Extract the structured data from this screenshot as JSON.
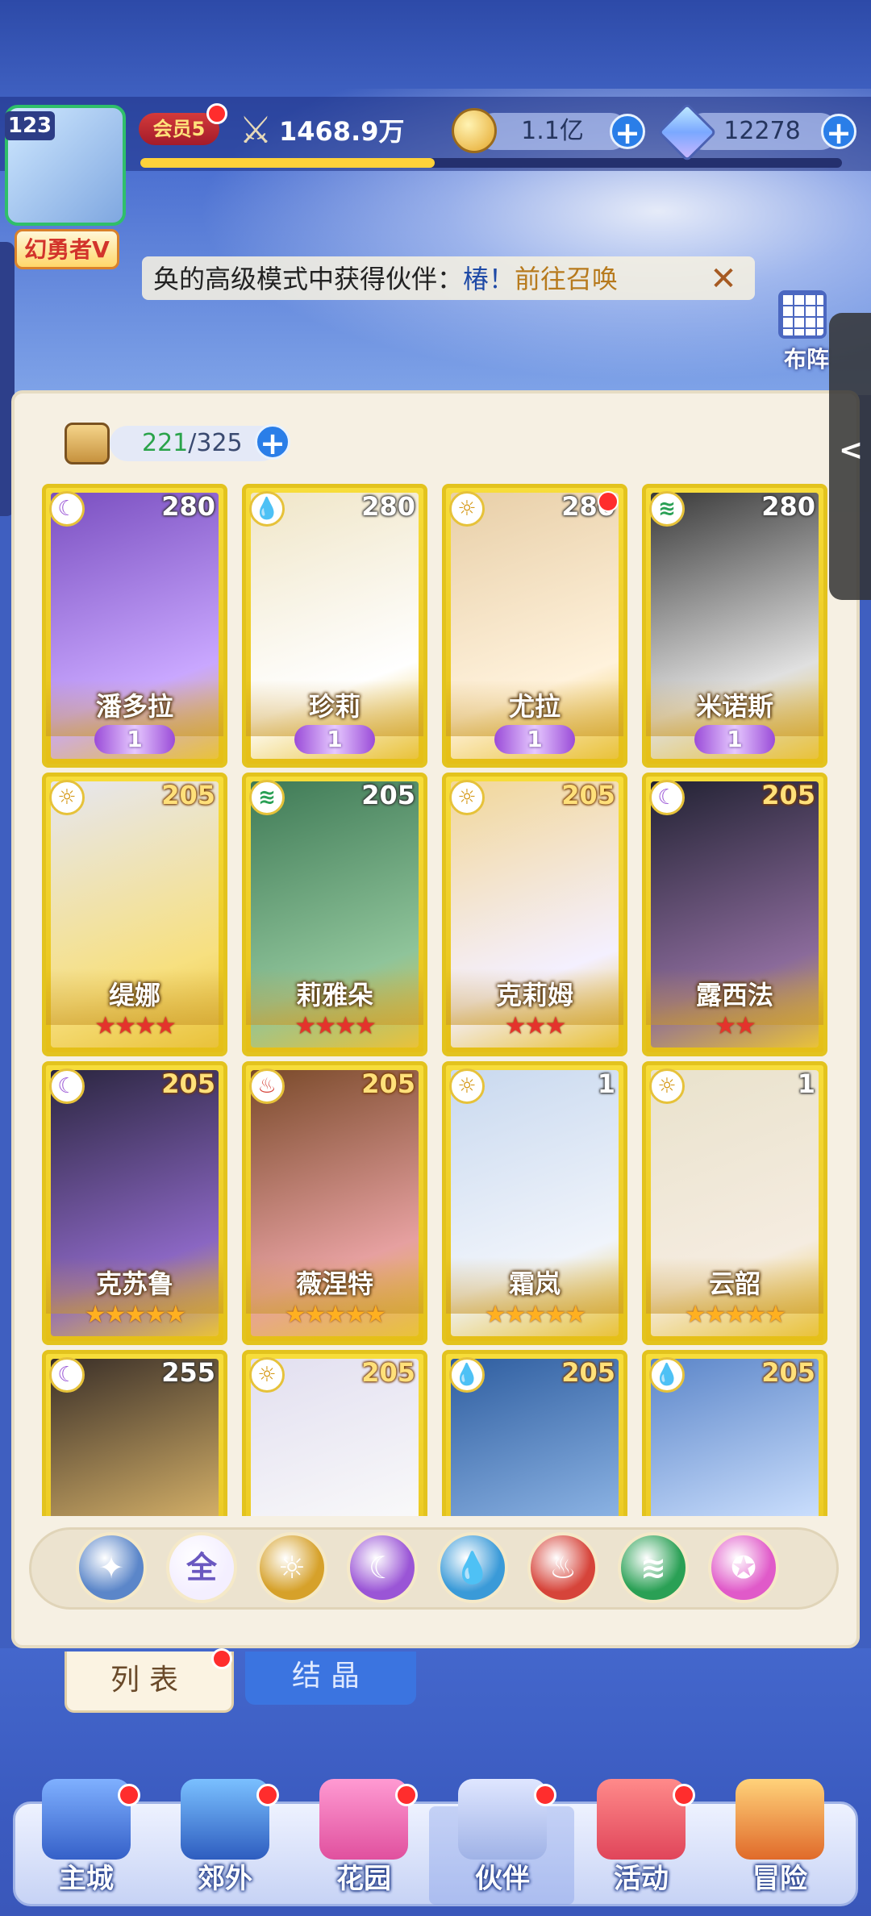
{
  "header": {
    "player_level": "123",
    "player_title": "幻勇者V",
    "vip_label": "会员5",
    "power": "1468.9万",
    "exp_progress": 0.42,
    "gold": "1.1亿",
    "diamonds": "12278"
  },
  "notice": {
    "text_prefix": "奂的高级模式中获得伙伴：",
    "partner": "椿！",
    "link": "前往召唤",
    "close": "✕"
  },
  "formation_label": "布阵",
  "side_tab_icon": "<",
  "bag": {
    "current": "221",
    "sep": "/",
    "max": "325"
  },
  "cards": [
    {
      "name": "潘多拉",
      "level": "280",
      "element": "moon",
      "elem_glyph": "☾",
      "elem_color": "#9a55d6",
      "stars": 0,
      "awaken": "1",
      "red_dot": false,
      "portrait": [
        "#7a4fc0",
        "#c9a7ff"
      ],
      "gold_level": false
    },
    {
      "name": "珍莉",
      "level": "280",
      "element": "water",
      "elem_glyph": "💧",
      "elem_color": "#3a9ad8",
      "stars": 0,
      "awaken": "1",
      "red_dot": false,
      "portrait": [
        "#f0e6c8",
        "#ffffff"
      ],
      "gold_level": false
    },
    {
      "name": "尤拉",
      "level": "280",
      "element": "light",
      "elem_glyph": "☼",
      "elem_color": "#d59a1a",
      "stars": 0,
      "awaken": "1",
      "red_dot": true,
      "portrait": [
        "#e8cfa8",
        "#fff2dc"
      ],
      "gold_level": false
    },
    {
      "name": "米诺斯",
      "level": "280",
      "element": "wind",
      "elem_glyph": "≋",
      "elem_color": "#2aa055",
      "stars": 0,
      "awaken": "1",
      "red_dot": false,
      "portrait": [
        "#3a3a3a",
        "#e0e0e0"
      ],
      "gold_level": false
    },
    {
      "name": "缇娜",
      "level": "205",
      "element": "light",
      "elem_glyph": "☼",
      "elem_color": "#d59a1a",
      "stars": 4,
      "star_color": "red",
      "red_dot": false,
      "portrait": [
        "#e6e6ef",
        "#f7e080"
      ],
      "gold_level": true
    },
    {
      "name": "莉雅朵",
      "level": "205",
      "element": "wind",
      "elem_glyph": "≋",
      "elem_color": "#2aa055",
      "stars": 4,
      "star_color": "red",
      "red_dot": false,
      "portrait": [
        "#3f7a56",
        "#8fc49a"
      ],
      "gold_level": false
    },
    {
      "name": "克莉姆",
      "level": "205",
      "element": "light",
      "elem_glyph": "☼",
      "elem_color": "#d59a1a",
      "stars": 3,
      "star_color": "red",
      "red_dot": false,
      "portrait": [
        "#f2d79a",
        "#f4f0ff"
      ],
      "gold_level": true
    },
    {
      "name": "露西法",
      "level": "205",
      "element": "moon",
      "elem_glyph": "☾",
      "elem_color": "#9a55d6",
      "stars": 2,
      "star_color": "red",
      "red_dot": false,
      "portrait": [
        "#222233",
        "#8a6a9a"
      ],
      "gold_level": true
    },
    {
      "name": "克苏鲁",
      "level": "205",
      "element": "moon",
      "elem_glyph": "☾",
      "elem_color": "#9a55d6",
      "stars": 5,
      "star_color": "gold",
      "red_dot": false,
      "portrait": [
        "#2b2640",
        "#8a66c2"
      ],
      "gold_level": true
    },
    {
      "name": "薇涅特",
      "level": "205",
      "element": "fire",
      "elem_glyph": "♨",
      "elem_color": "#d6443a",
      "stars": 5,
      "star_color": "gold",
      "red_dot": false,
      "portrait": [
        "#7a4a2a",
        "#e6a0a0"
      ],
      "gold_level": true
    },
    {
      "name": "霜岚",
      "level": "1",
      "element": "light",
      "elem_glyph": "☼",
      "elem_color": "#d59a1a",
      "stars": 5,
      "star_color": "gold",
      "red_dot": false,
      "portrait": [
        "#c9d9ef",
        "#f0f4fb"
      ],
      "gold_level": false
    },
    {
      "name": "云韶",
      "level": "1",
      "element": "light",
      "elem_glyph": "☼",
      "elem_color": "#d59a1a",
      "stars": 5,
      "star_color": "gold",
      "red_dot": false,
      "portrait": [
        "#e9e2cc",
        "#f5ece0"
      ],
      "gold_level": false
    },
    {
      "name": "",
      "level": "255",
      "element": "moon",
      "elem_glyph": "☾",
      "elem_color": "#9a55d6",
      "stars": 0,
      "red_dot": false,
      "portrait": [
        "#3a2f28",
        "#d9b46a"
      ],
      "gold_level": false
    },
    {
      "name": "",
      "level": "205",
      "element": "light",
      "elem_glyph": "☼",
      "elem_color": "#d59a1a",
      "stars": 0,
      "red_dot": false,
      "portrait": [
        "#e2dff0",
        "#fafafa"
      ],
      "gold_level": true
    },
    {
      "name": "",
      "level": "205",
      "element": "water",
      "elem_glyph": "💧",
      "elem_color": "#3a9ad8",
      "stars": 0,
      "red_dot": false,
      "portrait": [
        "#2f5ea0",
        "#8fb6e6"
      ],
      "gold_level": true
    },
    {
      "name": "",
      "level": "205",
      "element": "water",
      "elem_glyph": "💧",
      "elem_color": "#3a9ad8",
      "stars": 0,
      "red_dot": false,
      "portrait": [
        "#5c86c9",
        "#cfe2ff"
      ],
      "gold_level": true
    }
  ],
  "filters": [
    {
      "id": "special",
      "glyph": "✦",
      "color": "#5b86c9"
    },
    {
      "id": "all",
      "glyph": "全",
      "color": "#f4efff",
      "text_color": "#6a58c0"
    },
    {
      "id": "light",
      "glyph": "☼",
      "color": "#d6a12a"
    },
    {
      "id": "moon",
      "glyph": "☾",
      "color": "#9a55d6"
    },
    {
      "id": "water",
      "glyph": "💧",
      "color": "#3a9ad8"
    },
    {
      "id": "fire",
      "glyph": "♨",
      "color": "#d6443a"
    },
    {
      "id": "wind",
      "glyph": "≋",
      "color": "#2aa055"
    },
    {
      "id": "star",
      "glyph": "✪",
      "color": "#e05ac9"
    }
  ],
  "tabs": {
    "list": "列表",
    "crystal": "结晶"
  },
  "nav": [
    {
      "label": "主城",
      "color": [
        "#7fb0ff",
        "#3560c8"
      ],
      "dot": true
    },
    {
      "label": "郊外",
      "color": [
        "#7ac0ff",
        "#2e5dbf"
      ],
      "dot": true
    },
    {
      "label": "花园",
      "color": [
        "#ff9ad2",
        "#e0509e"
      ],
      "dot": true
    },
    {
      "label": "伙伴",
      "color": [
        "#dfe6ff",
        "#9fb2e6"
      ],
      "dot": true
    },
    {
      "label": "活动",
      "color": [
        "#ff8a8a",
        "#e0455a"
      ],
      "dot": true
    },
    {
      "label": "冒险",
      "color": [
        "#ffd27a",
        "#e06a2a"
      ],
      "dot": false
    }
  ]
}
